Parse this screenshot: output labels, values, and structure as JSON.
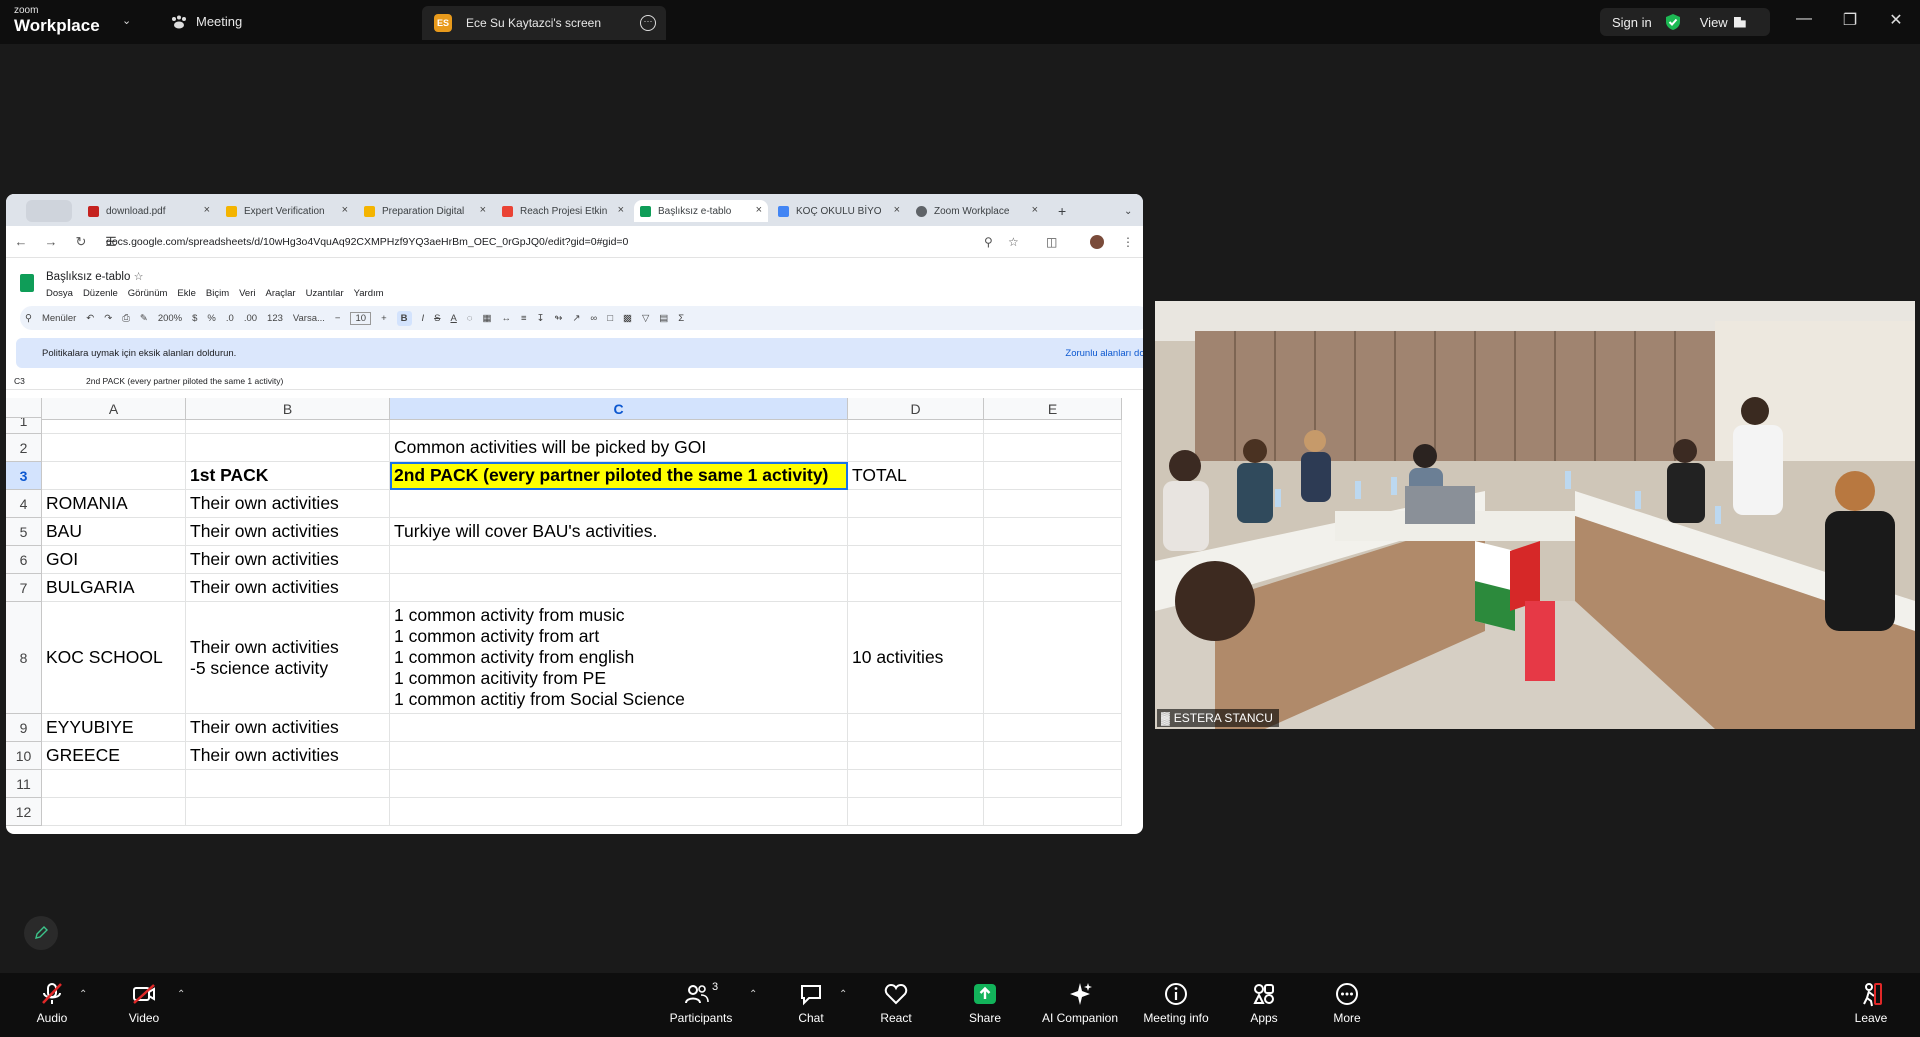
{
  "zoom": {
    "logo_small": "zoom",
    "logo_big": "Workplace",
    "meeting_label": "Meeting",
    "screen_badge": "ES",
    "screen_label": "Ece Su Kaytazci's screen",
    "sign_in": "Sign in",
    "view": "View"
  },
  "browser": {
    "tabs": [
      {
        "label": "download.pdf",
        "color": "#c5221f"
      },
      {
        "label": "Expert Verification",
        "color": "#f4b400"
      },
      {
        "label": "Preparation Digital",
        "color": "#f4b400"
      },
      {
        "label": "Reach Projesi Etkin",
        "color": "#ea4335"
      },
      {
        "label": "Başlıksız e-tablo",
        "color": "#0f9d58"
      },
      {
        "label": "KOÇ OKULU BİYO",
        "color": "#4285f4"
      },
      {
        "label": "Zoom Workplace",
        "color": "#5f6368"
      }
    ],
    "url": "docs.google.com/spreadsheets/d/10wHg3o4VquAq92CXMPHzf9YQ3aeHrBm_OEC_0rGpJQ0/edit?gid=0#gid=0"
  },
  "sheets": {
    "title": "Başlıksız e-tablo",
    "menu": [
      "Dosya",
      "Düzenle",
      "Görünüm",
      "Ekle",
      "Biçim",
      "Veri",
      "Araçlar",
      "Uzantılar",
      "Yardım"
    ],
    "toolbar": {
      "search": "Menüler",
      "zoom": "200%",
      "currency": "$",
      "percent": "%",
      "dec1": ".0",
      "dec2": ".00",
      "num": "123",
      "font": "Varsa...",
      "size": "10"
    },
    "policy_text": "Politikalara uymak için eksik alanları doldurun.",
    "policy_link": "Zorunlu alanları dold",
    "cell_ref": "C3",
    "formula": "2nd PACK (every partner piloted the same 1 activity)",
    "columns": [
      "A",
      "B",
      "C",
      "D",
      "E"
    ],
    "rows": [
      {
        "num": "1",
        "a": "",
        "b": "",
        "c": "",
        "d": ""
      },
      {
        "num": "2",
        "a": "",
        "b": "",
        "c": "Common activities will be picked by GOI",
        "d": ""
      },
      {
        "num": "3",
        "a": "",
        "b": "1st PACK",
        "c": "2nd PACK (every partner piloted the same 1 activity)",
        "d": "TOTAL"
      },
      {
        "num": "4",
        "a": "ROMANIA",
        "b": "Their own activities",
        "c": "",
        "d": ""
      },
      {
        "num": "5",
        "a": "BAU",
        "b": "Their own activities",
        "c": "Turkiye will cover BAU's activities.",
        "d": ""
      },
      {
        "num": "6",
        "a": "GOI",
        "b": "Their own activities",
        "c": "",
        "d": ""
      },
      {
        "num": "7",
        "a": "BULGARIA",
        "b": "Their own activities",
        "c": "",
        "d": ""
      },
      {
        "num": "8",
        "a": "KOC SCHOOL",
        "b": "Their own activities\n-5 science activity",
        "c": "1 common activity from music\n1 common activity from art\n1 common activity from english\n1 common acitivity from PE\n1 common actitiy from Social Science",
        "d": "10 activities"
      },
      {
        "num": "9",
        "a": "EYYUBIYE",
        "b": "Their own activities",
        "c": "",
        "d": ""
      },
      {
        "num": "10",
        "a": "GREECE",
        "b": "Their own activities",
        "c": "",
        "d": ""
      },
      {
        "num": "11",
        "a": "",
        "b": "",
        "c": "",
        "d": ""
      },
      {
        "num": "12",
        "a": "",
        "b": "",
        "c": "",
        "d": ""
      }
    ]
  },
  "video": {
    "participant": "ESTERA STANCU"
  },
  "controls": {
    "audio": "Audio",
    "video": "Video",
    "participants": "Participants",
    "participants_count": "3",
    "chat": "Chat",
    "react": "React",
    "share": "Share",
    "ai": "AI Companion",
    "info": "Meeting info",
    "apps": "Apps",
    "more": "More",
    "leave": "Leave"
  }
}
